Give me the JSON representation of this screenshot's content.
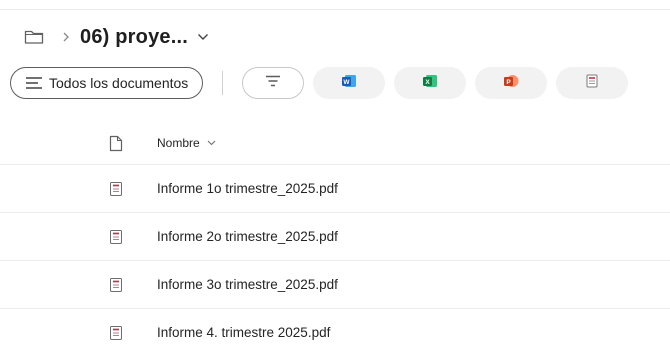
{
  "breadcrumb": {
    "separator": ">",
    "current": "06) proye..."
  },
  "toolbar": {
    "view_label": "Todos los documentos",
    "chips": [
      {
        "name": "filter",
        "icon": "filter-lines-icon"
      },
      {
        "name": "word",
        "icon": "word-icon",
        "letter": "W",
        "color": "#185abd"
      },
      {
        "name": "excel",
        "icon": "excel-icon",
        "letter": "X",
        "color": "#107c41"
      },
      {
        "name": "powerpoint",
        "icon": "powerpoint-icon",
        "letter": "P",
        "color": "#c43e1c"
      },
      {
        "name": "pdf",
        "icon": "pdf-icon",
        "color": "#c4314b"
      }
    ]
  },
  "list": {
    "column_name": "Nombre",
    "files": [
      {
        "name": "Informe 1o trimestre_2025.pdf"
      },
      {
        "name": "Informe 2o trimestre_2025.pdf"
      },
      {
        "name": "Informe 3o trimestre_2025.pdf"
      },
      {
        "name": "Informe 4. trimestre 2025.pdf"
      }
    ]
  },
  "colors": {
    "text": "#242424",
    "pdf_red": "#c4314b",
    "divider": "#ededed"
  }
}
